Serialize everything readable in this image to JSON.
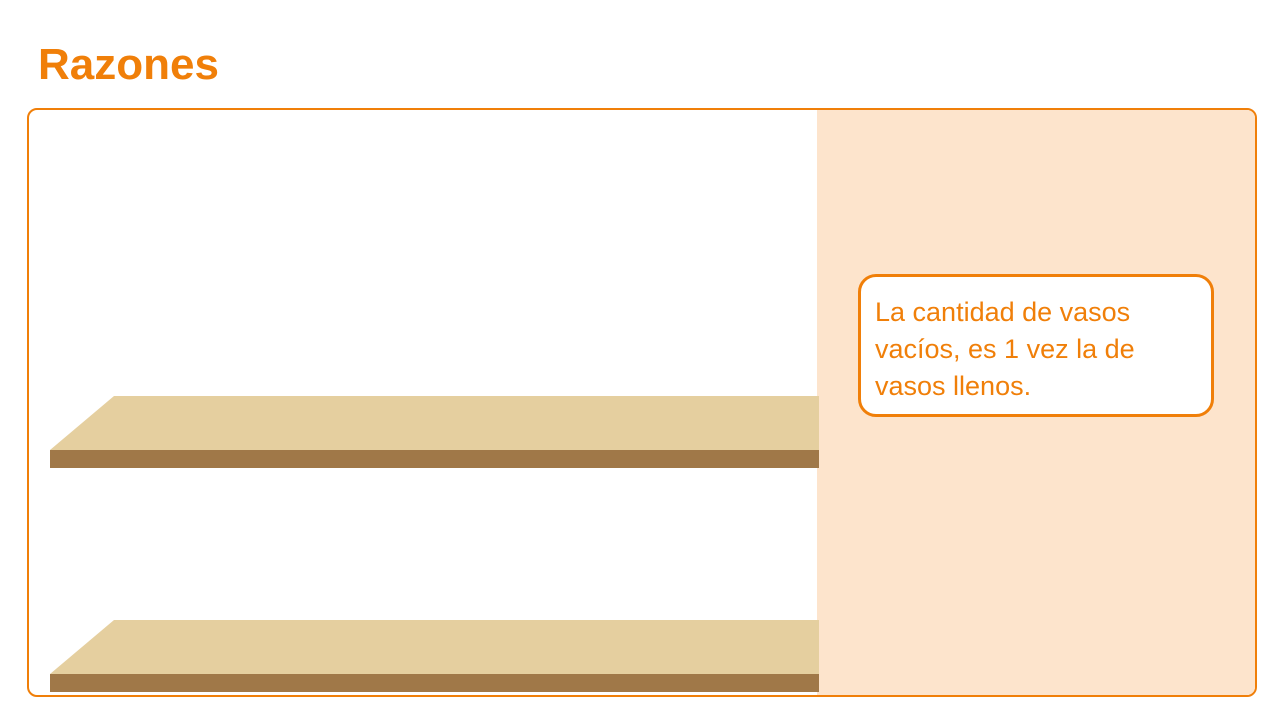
{
  "header": {
    "title": "Razones"
  },
  "callout": {
    "text": "La cantidad de vasos vacíos, es 1 vez la de vasos llenos."
  },
  "colors": {
    "accent": "#f07f09",
    "panel_background": "#fde4cc",
    "shelf_top": "#e5cf9f",
    "shelf_front": "#a07848"
  }
}
